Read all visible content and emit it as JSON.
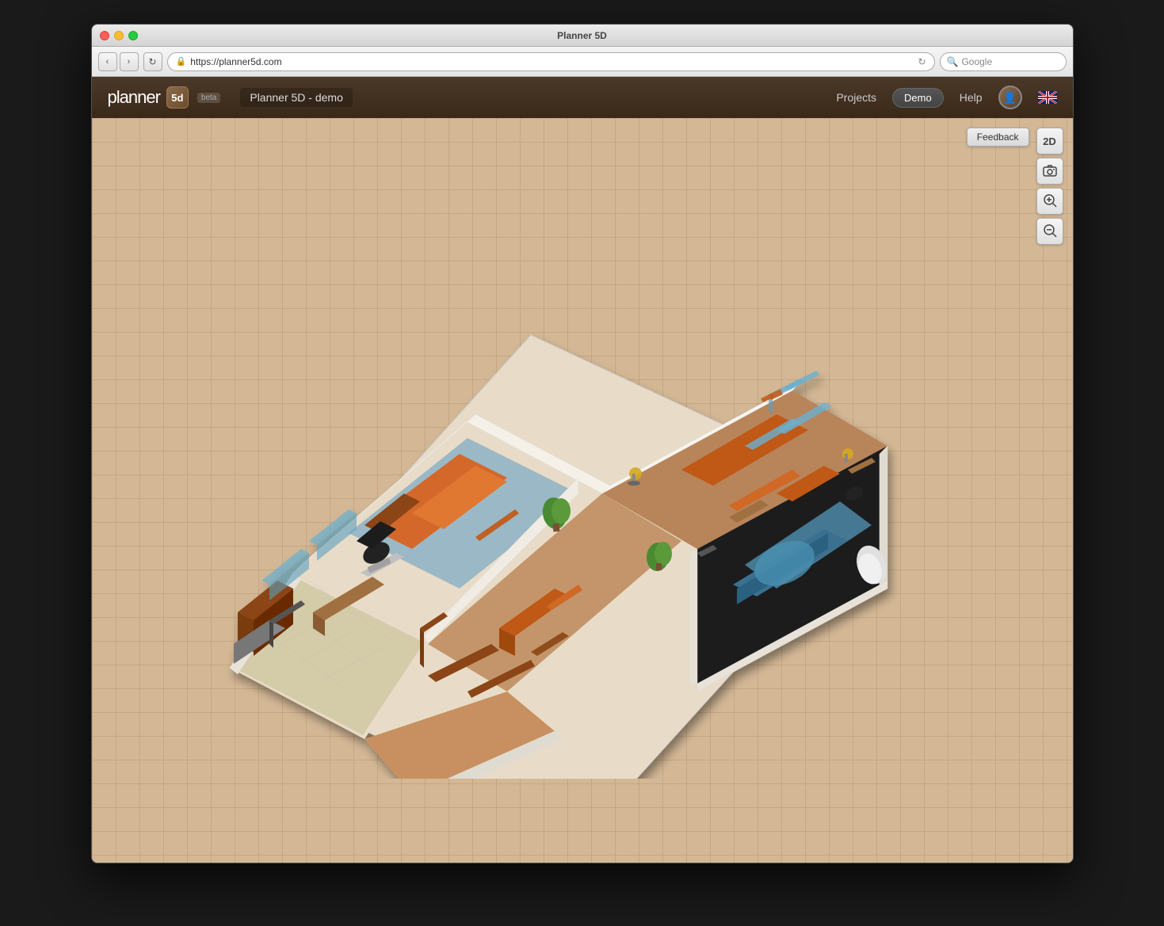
{
  "window": {
    "title": "Planner 5D",
    "os": "mac"
  },
  "browser": {
    "back_label": "‹",
    "forward_label": "›",
    "reload_label": "↻",
    "url": "https://planner5d.com",
    "search_placeholder": "Google"
  },
  "app": {
    "logo_text": "planner",
    "logo_icon": "5d",
    "beta_label": "beta",
    "project_name": "Planner 5D - demo",
    "nav": {
      "projects_label": "Projects",
      "demo_label": "Demo",
      "help_label": "Help"
    }
  },
  "toolbar": {
    "feedback_label": "Feedback",
    "view_2d_label": "2D",
    "screenshot_icon": "camera",
    "zoom_in_icon": "zoom-in",
    "zoom_out_icon": "zoom-out"
  },
  "viewport": {
    "background_color": "#d4b896",
    "grid_color": "#c4a886"
  }
}
